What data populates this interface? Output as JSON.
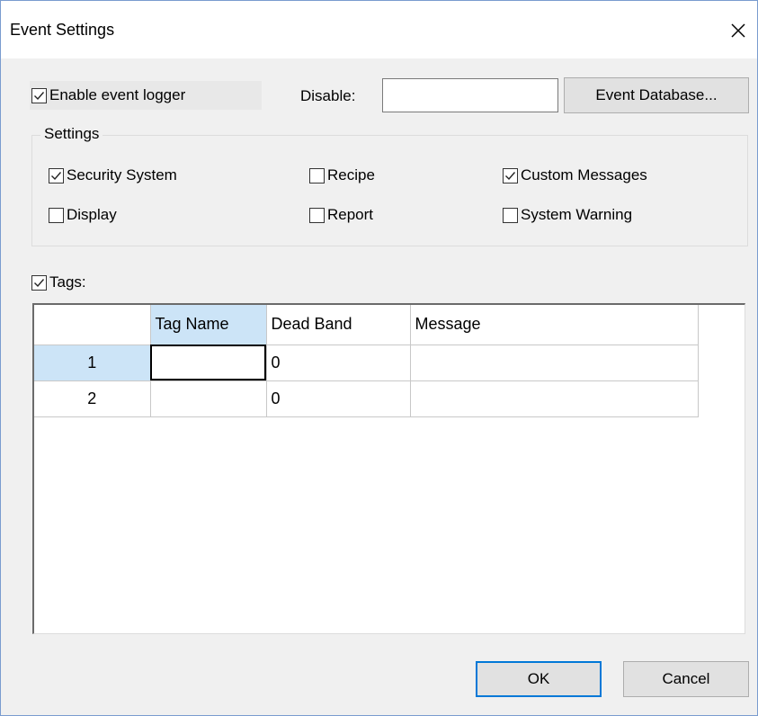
{
  "window": {
    "title": "Event Settings",
    "close_icon": "close-icon"
  },
  "logger": {
    "enable_label": "Enable event logger",
    "enable_checked": true,
    "disable_label": "Disable:",
    "disable_value": "",
    "event_db_button": "Event Database..."
  },
  "settings": {
    "group_label": "Settings",
    "items": [
      {
        "label": "Security System",
        "checked": true
      },
      {
        "label": "Recipe",
        "checked": false
      },
      {
        "label": "Custom Messages",
        "checked": true
      },
      {
        "label": "Display",
        "checked": false
      },
      {
        "label": "Report",
        "checked": false
      },
      {
        "label": "System Warning",
        "checked": false
      }
    ]
  },
  "tags": {
    "label": "Tags:",
    "checked": true,
    "columns": [
      "",
      "Tag Name",
      "Dead Band",
      "Message"
    ],
    "rows": [
      {
        "num": "1",
        "tag_name": "",
        "dead_band": "0",
        "message": ""
      },
      {
        "num": "2",
        "tag_name": "",
        "dead_band": "0",
        "message": ""
      }
    ]
  },
  "footer": {
    "ok_label": "OK",
    "cancel_label": "Cancel"
  },
  "colors": {
    "accent": "#0078d7",
    "selected_header": "#cce4f7",
    "background": "#f0f0f0"
  }
}
